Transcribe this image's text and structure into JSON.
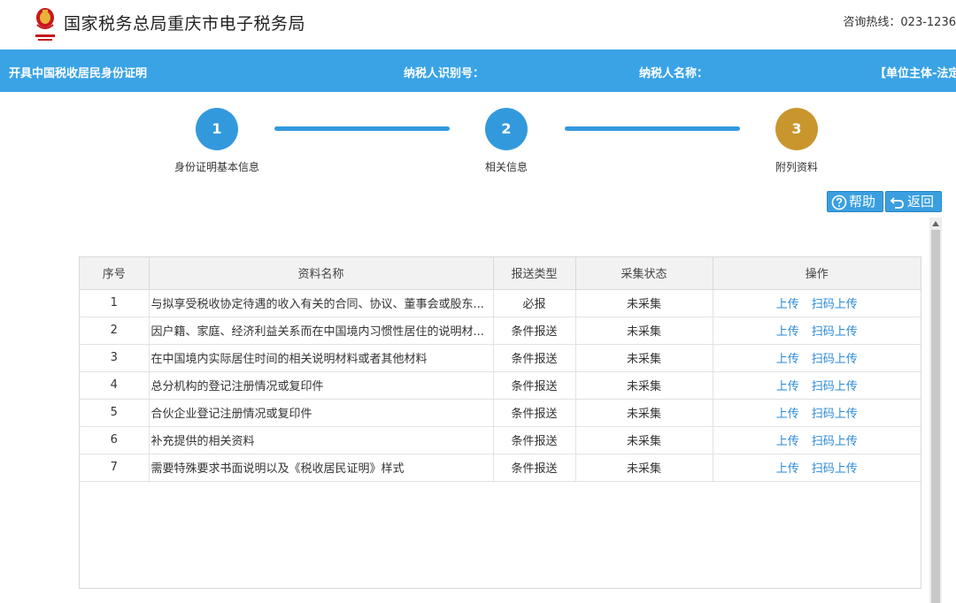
{
  "header": {
    "site_title": "国家税务总局重庆市电子税务局",
    "hotline": "咨询热线：023-1236"
  },
  "info_bar": {
    "title": "开具中国税收居民身份证明",
    "taxpayer_id_label": "纳税人识别号：",
    "taxpayer_name_label": "纳税人名称：",
    "subject_label": "【单位主体-法定"
  },
  "steps": [
    {
      "number": "1",
      "label": "身份证明基本信息",
      "state": "complete"
    },
    {
      "number": "2",
      "label": "相关信息",
      "state": "complete"
    },
    {
      "number": "3",
      "label": "附列资料",
      "state": "active"
    }
  ],
  "buttons": {
    "help": "帮助",
    "return": "返回"
  },
  "table": {
    "headers": [
      "序号",
      "资料名称",
      "报送类型",
      "采集状态",
      "操作"
    ],
    "rows": [
      {
        "no": "1",
        "name": "与拟享受税收协定待遇的收入有关的合同、协议、董事会或股东...",
        "type": "必报",
        "status": "未采集",
        "upload": "上传",
        "scan_upload": "扫码上传"
      },
      {
        "no": "2",
        "name": "因户籍、家庭、经济利益关系而在中国境内习惯性居住的说明材...",
        "type": "条件报送",
        "status": "未采集",
        "upload": "上传",
        "scan_upload": "扫码上传"
      },
      {
        "no": "3",
        "name": "在中国境内实际居住时间的相关说明材料或者其他材料",
        "type": "条件报送",
        "status": "未采集",
        "upload": "上传",
        "scan_upload": "扫码上传"
      },
      {
        "no": "4",
        "name": "总分机构的登记注册情况或复印件",
        "type": "条件报送",
        "status": "未采集",
        "upload": "上传",
        "scan_upload": "扫码上传"
      },
      {
        "no": "5",
        "name": "合伙企业登记注册情况或复印件",
        "type": "条件报送",
        "status": "未采集",
        "upload": "上传",
        "scan_upload": "扫码上传"
      },
      {
        "no": "6",
        "name": "补充提供的相关资料",
        "type": "条件报送",
        "status": "未采集",
        "upload": "上传",
        "scan_upload": "扫码上传"
      },
      {
        "no": "7",
        "name": "需要特殊要求书面说明以及《税收居民证明》样式",
        "type": "条件报送",
        "status": "未采集",
        "upload": "上传",
        "scan_upload": "扫码上传"
      }
    ]
  },
  "colors": {
    "primary_blue": "#3aa3e6",
    "step_blue": "#3399dd",
    "step_active": "#c9962e",
    "link": "#2a8ad6",
    "emblem_red": "#c8161d"
  },
  "icons": {
    "emblem": "tax-emblem-icon",
    "help": "question-circle-icon",
    "return": "return-arrow-icon"
  }
}
